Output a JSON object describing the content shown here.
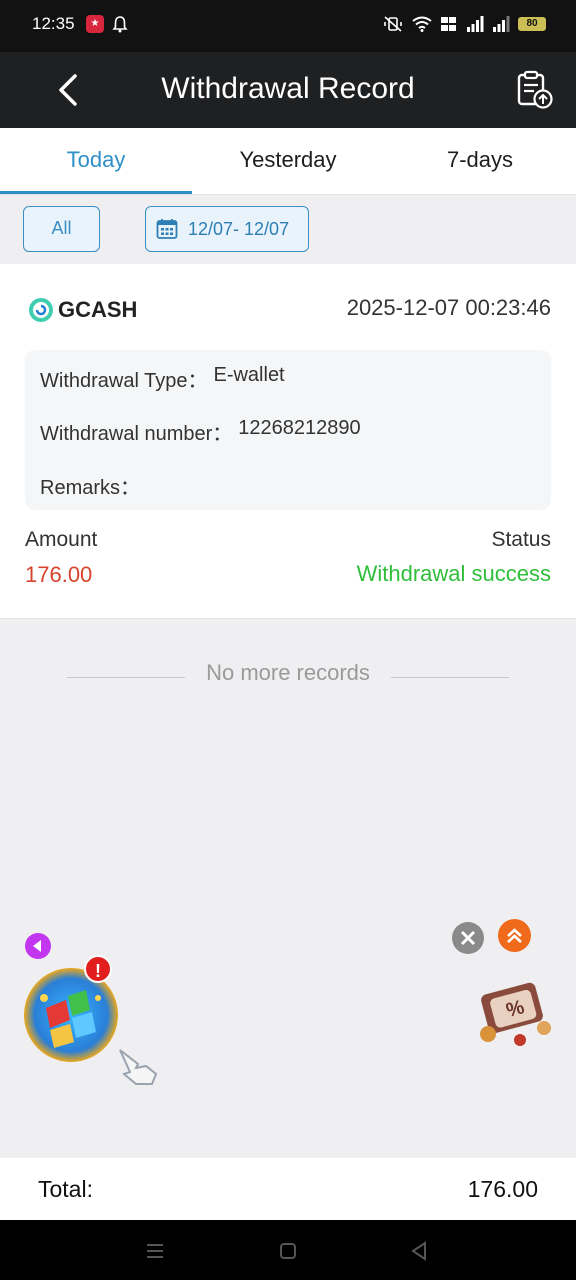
{
  "status_bar": {
    "time": "12:35",
    "battery": "80"
  },
  "header": {
    "title": "Withdrawal Record"
  },
  "tabs": [
    {
      "label": "Today",
      "active": true
    },
    {
      "label": "Yesterday",
      "active": false
    },
    {
      "label": "7-days",
      "active": false
    }
  ],
  "filters": {
    "type_label": "All",
    "date_range": "12/07- 12/07"
  },
  "record": {
    "channel": "GCASH",
    "datetime": "2025-12-07 00:23:46",
    "type_label": "Withdrawal Type：",
    "type_value": "E-wallet",
    "number_label": "Withdrawal number：",
    "number_value": "12268212890",
    "remarks_label": "Remarks：",
    "remarks_value": "",
    "amount_label": "Amount",
    "amount_value": "176.00",
    "status_label": "Status",
    "status_value": "Withdrawal success"
  },
  "list_end_text": "No more records",
  "floating": {
    "alert_mark": "!"
  },
  "footer": {
    "total_label": "Total:",
    "total_value": "176.00"
  },
  "colors": {
    "accent": "#2f90c7",
    "amount": "#d8432e",
    "success": "#2fbe3a",
    "header_bg": "#1f2022"
  }
}
